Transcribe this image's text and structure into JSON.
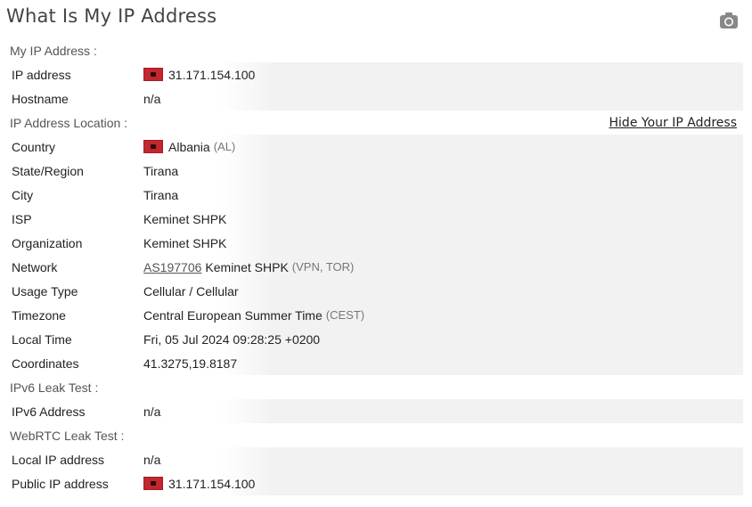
{
  "page": {
    "title": "What Is My IP Address"
  },
  "icons": {
    "camera": "camera-icon",
    "flag": "albania-flag-icon"
  },
  "my_ip": {
    "header": "My IP Address :",
    "rows": [
      {
        "label": "IP address",
        "value": "31.171.154.100",
        "flag": true
      },
      {
        "label": "Hostname",
        "value": "n/a"
      }
    ]
  },
  "location": {
    "header": "IP Address Location :",
    "hide_link": "Hide Your IP Address",
    "country": {
      "label": "Country",
      "value": "Albania",
      "code": "(AL)"
    },
    "state": {
      "label": "State/Region",
      "value": "Tirana"
    },
    "city": {
      "label": "City",
      "value": "Tirana"
    },
    "isp": {
      "label": "ISP",
      "value": "Keminet SHPK"
    },
    "organization": {
      "label": "Organization",
      "value": "Keminet SHPK"
    },
    "network": {
      "label": "Network",
      "asn": "AS197706",
      "value": "Keminet SHPK",
      "tags": "(VPN, TOR)"
    },
    "usage_type": {
      "label": "Usage Type",
      "value": "Cellular / Cellular"
    },
    "timezone": {
      "label": "Timezone",
      "value": "Central European Summer Time",
      "abbr": "(CEST)"
    },
    "local_time": {
      "label": "Local Time",
      "value": "Fri, 05 Jul 2024 09:28:25 +0200"
    },
    "coordinates": {
      "label": "Coordinates",
      "value": "41.3275,19.8187"
    }
  },
  "ipv6": {
    "header": "IPv6 Leak Test :",
    "address": {
      "label": "IPv6 Address",
      "value": "n/a"
    }
  },
  "webrtc": {
    "header": "WebRTC Leak Test :",
    "local": {
      "label": "Local IP address",
      "value": "n/a"
    },
    "public": {
      "label": "Public IP address",
      "value": "31.171.154.100"
    }
  },
  "colors": {
    "flag_red": "#c2262e",
    "row_bg": "#f2f2f2",
    "title": "#444444"
  }
}
